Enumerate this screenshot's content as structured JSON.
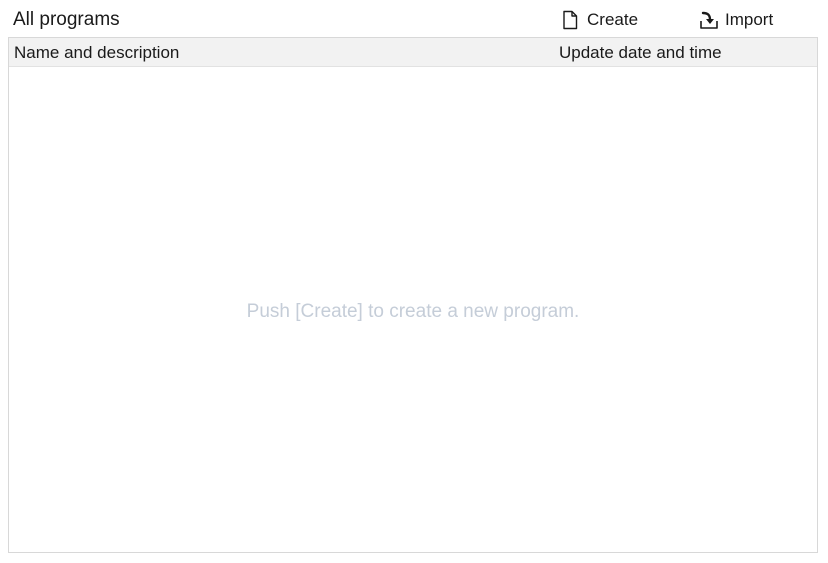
{
  "header": {
    "title": "All programs",
    "actions": {
      "create_label": "Create",
      "import_label": "Import"
    }
  },
  "table": {
    "columns": [
      "Name and description",
      "Update date and time"
    ],
    "rows": [],
    "empty_message": "Push [Create] to create a new program."
  },
  "icons": {
    "create": "new-document-icon",
    "import": "import-icon"
  },
  "colors": {
    "header_background": "#f2f2f2",
    "border": "#d8d8d8",
    "empty_text": "#c5cdd8"
  }
}
